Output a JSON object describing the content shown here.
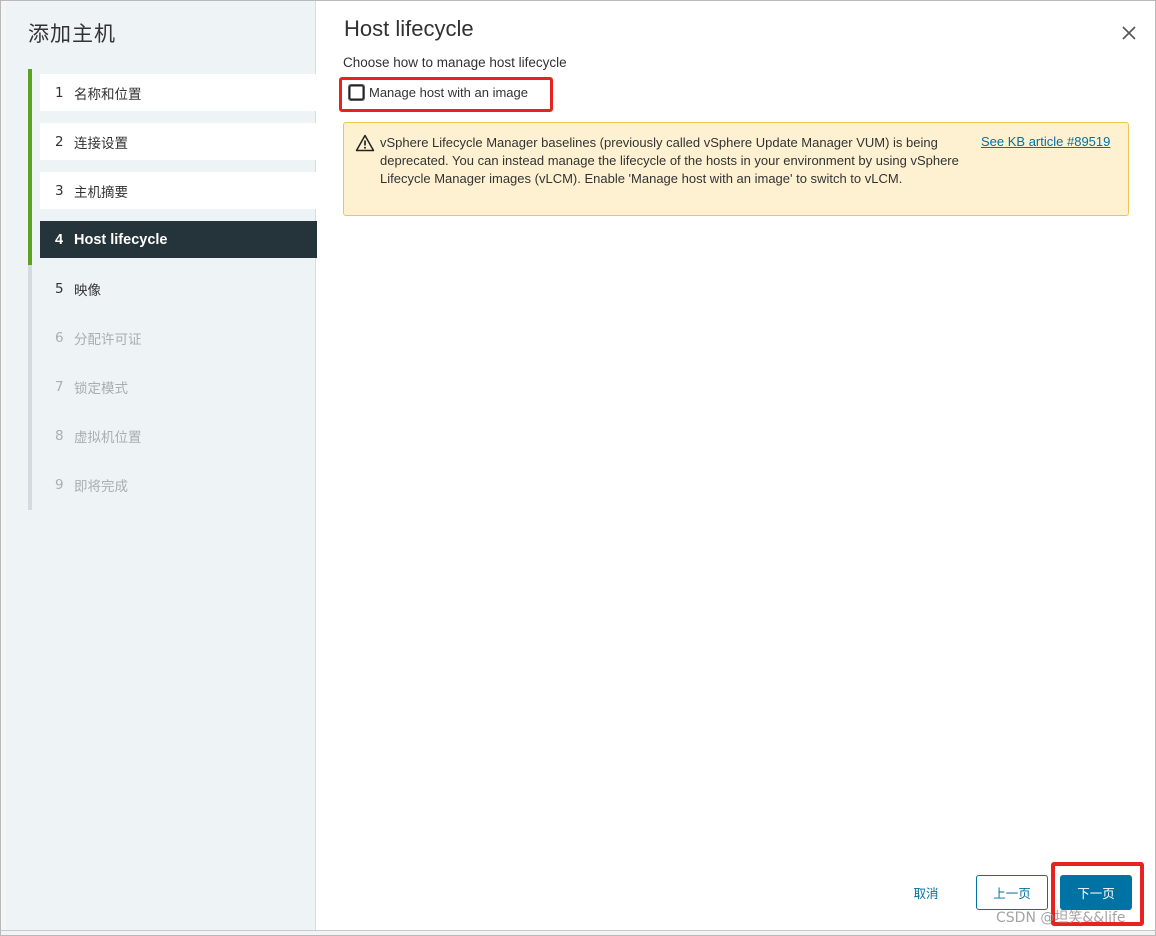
{
  "wizard": {
    "title": "添加主机",
    "steps": [
      {
        "num": "1",
        "label": "名称和位置",
        "state": "done"
      },
      {
        "num": "2",
        "label": "连接设置",
        "state": "done"
      },
      {
        "num": "3",
        "label": "主机摘要",
        "state": "done"
      },
      {
        "num": "4",
        "label": "Host lifecycle",
        "state": "current"
      },
      {
        "num": "5",
        "label": "映像",
        "state": "next"
      },
      {
        "num": "6",
        "label": "分配许可证",
        "state": "disabled"
      },
      {
        "num": "7",
        "label": "锁定模式",
        "state": "disabled"
      },
      {
        "num": "8",
        "label": "虚拟机位置",
        "state": "disabled"
      },
      {
        "num": "9",
        "label": "即将完成",
        "state": "disabled"
      }
    ]
  },
  "main": {
    "title": "Host lifecycle",
    "subtitle": "Choose how to manage host lifecycle",
    "checkbox": {
      "label": "Manage host with an image",
      "checked": false
    },
    "alert": {
      "icon": "warning-icon",
      "text": "vSphere Lifecycle Manager baselines (previously called vSphere Update Manager VUM) is being deprecated. You can instead manage the lifecycle of the hosts in your environment by using vSphere Lifecycle Manager images (vLCM). Enable 'Manage host with an image' to switch to vLCM.",
      "link": "See KB article #89519"
    }
  },
  "footer": {
    "cancel": "取消",
    "prev": "上一页",
    "next": "下一页"
  },
  "watermark": "CSDN @坦笑&&life",
  "colors": {
    "accent": "#0072a3",
    "current_step_bg": "#25343b",
    "progress_green": "#5aa220",
    "alert_bg": "#fdf1d2",
    "alert_border": "#f0c453",
    "annotation_red": "#e8221f"
  }
}
